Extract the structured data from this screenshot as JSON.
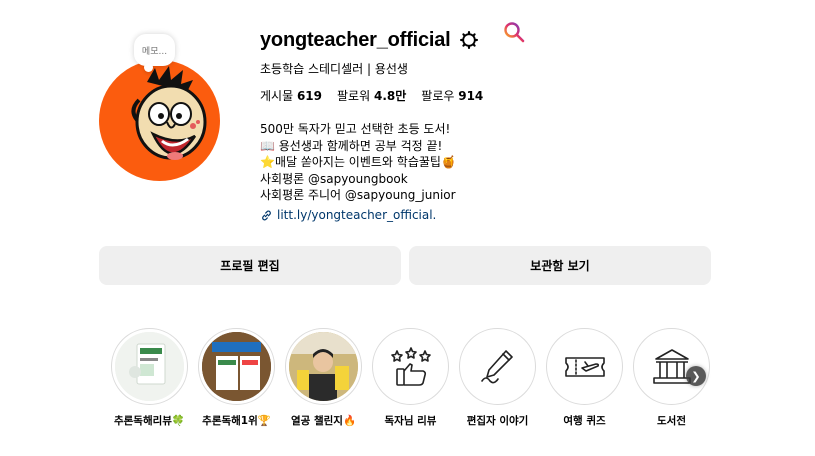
{
  "profile": {
    "memo_placeholder": "메모...",
    "username": "yongteacher_official",
    "subtitle": "초등학습 스테디셀러 | 용선생",
    "stats": {
      "posts_label": "게시물",
      "posts_value": "619",
      "followers_label": "팔로워",
      "followers_value": "4.8만",
      "following_label": "팔로우",
      "following_value": "914"
    },
    "bio": [
      "500만 독자가 믿고 선택한 초등 도서!",
      "📖 용선생과 함께하면 공부 걱정 끝!",
      "⭐매달 쏟아지는 이벤트와 학습꿀팁🍯",
      "사회평론 @sapyoungbook",
      "사회평론 주니어 @sapyoung_junior"
    ],
    "link": "litt.ly/yongteacher_official."
  },
  "buttons": {
    "edit_profile": "프로필 편집",
    "view_archive": "보관함 보기"
  },
  "highlights": [
    {
      "label": "추론독해리뷰🍀",
      "icon": "book-cover"
    },
    {
      "label": "추론독해1위🏆",
      "icon": "book-cover-bestseller"
    },
    {
      "label": "열공 챌린지🔥",
      "icon": "child-photo"
    },
    {
      "label": "독자님 리뷰",
      "icon": "thumbs-up-stars-icon"
    },
    {
      "label": "편집자 이야기",
      "icon": "pencil-icon"
    },
    {
      "label": "여행 퀴즈",
      "icon": "plane-ticket-icon"
    },
    {
      "label": "도서전",
      "icon": "museum-icon"
    }
  ],
  "colors": {
    "avatar_bg": "#fb5c0e",
    "button_bg": "#efefef",
    "link": "#00376b"
  }
}
